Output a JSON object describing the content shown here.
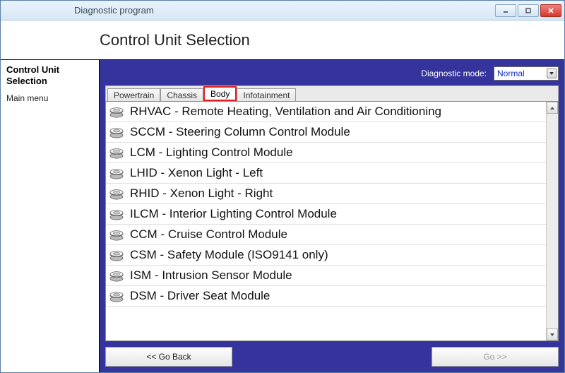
{
  "window": {
    "title": "Diagnostic program"
  },
  "header": {
    "title": "Control Unit Selection"
  },
  "sidebar": {
    "selection_label": "Control Unit Selection",
    "main_menu_label": "Main menu"
  },
  "diag_mode": {
    "label": "Diagnostic mode:",
    "value": "Normal"
  },
  "tabs": [
    {
      "label": "Powertrain"
    },
    {
      "label": "Chassis"
    },
    {
      "label": "Body"
    },
    {
      "label": "Infotainment"
    }
  ],
  "active_tab_index": 2,
  "modules": [
    "RHVAC - Remote Heating, Ventilation and Air Conditioning",
    "SCCM - Steering Column Control Module",
    "LCM - Lighting Control Module",
    "LHID - Xenon Light - Left",
    "RHID - Xenon Light - Right",
    "ILCM - Interior Lighting Control Module",
    "CCM - Cruise Control Module",
    "CSM - Safety Module (ISO9141 only)",
    "ISM - Intrusion Sensor Module",
    "DSM - Driver Seat Module"
  ],
  "footer": {
    "back_label": "<< Go Back",
    "go_label": "Go >>"
  }
}
